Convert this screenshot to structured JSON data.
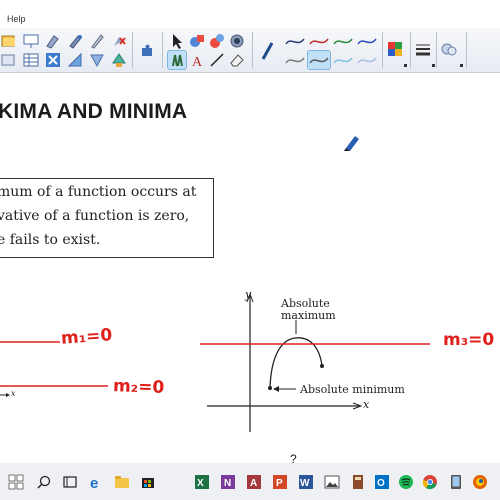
{
  "menu": {
    "help_label": "Help"
  },
  "toolbar": {
    "icons": [
      "open-icon",
      "whiteboard-icon",
      "eraser-brush-icon",
      "pen-style-icon",
      "clear-icon",
      "layers-icon",
      "table-icon",
      "close-box-icon",
      "fill-icon",
      "shape-icon",
      "recycle-icon",
      "puzzle-icon",
      "select-arrow-icon",
      "shapes-icon",
      "fill-bucket-icon",
      "camera-icon",
      "pen-tool-icon",
      "text-icon",
      "line-icon",
      "eraser-icon",
      "colors-icon",
      "line-width-icon",
      "page-icon"
    ],
    "colors": {
      "toolbar_bg": "#e9edf3",
      "selected": "#bfe0f6"
    }
  },
  "slide": {
    "title": "KIMA AND MINIMA",
    "definition_lines": [
      "mum of a function occurs at",
      "vative of a function is zero,",
      "e fails to exist."
    ],
    "graph": {
      "y_axis_label": "y",
      "x_axis_label": "x",
      "max_label_line1": "Absolute",
      "max_label_line2": "maximum",
      "min_label": "Absolute minimum"
    },
    "small_axis_label": "x"
  },
  "annotations": {
    "m1": "m₁=0",
    "m2": "m₂=0",
    "m3": "m₃=0",
    "ink_color": "#e0201b"
  },
  "bottom_text_fragment": "?",
  "taskbar": {
    "apps": [
      "windows-icon",
      "search-icon",
      "task-view-icon",
      "edge-icon",
      "file-explorer-icon",
      "store-icon",
      "excel-icon",
      "onenote-icon",
      "access-icon",
      "powerpoint-icon",
      "word-icon",
      "photos-icon",
      "outlook-icon",
      "spotify-icon",
      "chrome-icon",
      "notebook-icon",
      "firefox-icon"
    ]
  }
}
